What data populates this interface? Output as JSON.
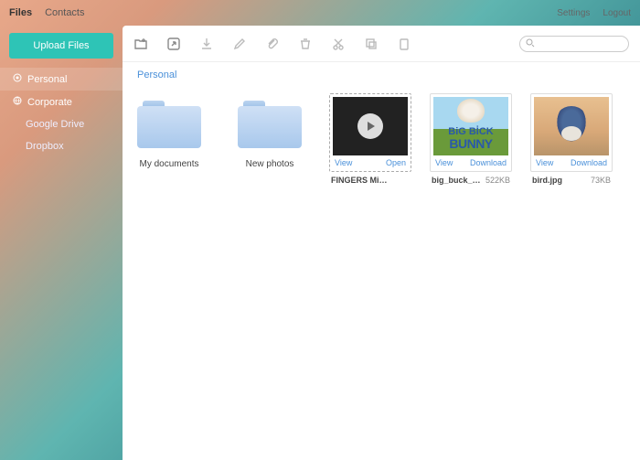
{
  "topbar": {
    "tabs": [
      "Files",
      "Contacts"
    ],
    "active_tab": "Files",
    "settings": "Settings",
    "logout": "Logout"
  },
  "sidebar": {
    "upload_label": "Upload Files",
    "items": [
      {
        "label": "Personal",
        "icon": "circle-dot-icon",
        "active": true
      },
      {
        "label": "Corporate",
        "icon": "globe-icon",
        "active": false
      }
    ],
    "subitems": [
      {
        "label": "Google Drive"
      },
      {
        "label": "Dropbox"
      }
    ]
  },
  "toolbar_icons": [
    "new-folder-icon",
    "share-icon",
    "download-icon",
    "edit-icon",
    "attach-icon",
    "trash-icon",
    "cut-icon",
    "copy-icon",
    "delete-icon"
  ],
  "search": {
    "placeholder": ""
  },
  "breadcrumb": "Personal",
  "folders": [
    {
      "name": "My documents"
    },
    {
      "name": "New photos"
    }
  ],
  "files": [
    {
      "name": "FINGERS Mitchell C...",
      "size": "",
      "thumb_type": "video",
      "action_left": "View",
      "action_right": "Open"
    },
    {
      "name": "big_buck_bu...",
      "size": "522KB",
      "thumb_type": "bunny",
      "bunny_line1": "BiG BİCK",
      "bunny_line2": "BUNNY",
      "action_left": "View",
      "action_right": "Download"
    },
    {
      "name": "bird.jpg",
      "size": "73KB",
      "thumb_type": "bird",
      "action_left": "View",
      "action_right": "Download"
    }
  ]
}
